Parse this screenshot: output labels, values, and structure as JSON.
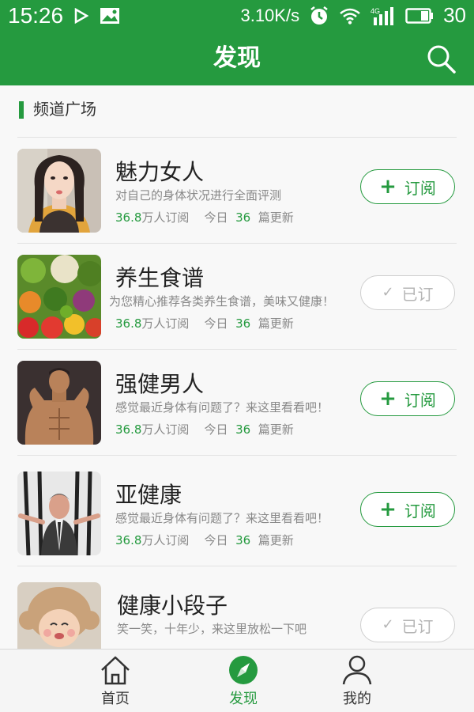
{
  "status_bar": {
    "time": "15:26",
    "net_speed": "3.10K/s",
    "network": "4G",
    "battery": "30"
  },
  "header": {
    "title": "发现"
  },
  "section": {
    "title": "频道广场"
  },
  "channels": [
    {
      "name": "魅力女人",
      "desc": "对自己的身体状况进行全面评测",
      "subs_num": "36.8",
      "subs_unit": "万人订阅",
      "today": "今日",
      "updates": "36",
      "updates_unit": "篇更新",
      "button": "订阅",
      "subscribed": false
    },
    {
      "name": "养生食谱",
      "desc": "为您精心推荐各类养生食谱，美味又健康！",
      "subs_num": "36.8",
      "subs_unit": "万人订阅",
      "today": "今日",
      "updates": "36",
      "updates_unit": "篇更新",
      "button": "已订",
      "subscribed": true
    },
    {
      "name": "强健男人",
      "desc": "感觉最近身体有问题了？来这里看看吧！",
      "subs_num": "36.8",
      "subs_unit": "万人订阅",
      "today": "今日",
      "updates": "36",
      "updates_unit": "篇更新",
      "button": "订阅",
      "subscribed": false
    },
    {
      "name": "亚健康",
      "desc": "感觉最近身体有问题了？来这里看看吧！",
      "subs_num": "36.8",
      "subs_unit": "万人订阅",
      "today": "今日",
      "updates": "36",
      "updates_unit": "篇更新",
      "button": "订阅",
      "subscribed": false
    },
    {
      "name": "健康小段子",
      "desc": "笑一笑，十年少，来这里放松一下吧",
      "subs_num": "",
      "subs_unit": "",
      "today": "",
      "updates": "",
      "updates_unit": "",
      "button": "已订",
      "subscribed": true
    }
  ],
  "tabs": [
    {
      "label": "首页",
      "active": false
    },
    {
      "label": "发现",
      "active": true
    },
    {
      "label": "我的",
      "active": false
    }
  ],
  "colors": {
    "accent": "#259a3f",
    "inactive": "#333333"
  }
}
